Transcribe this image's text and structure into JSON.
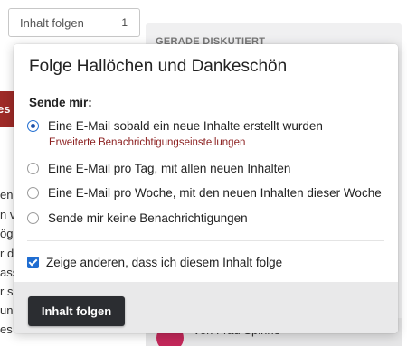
{
  "trigger": {
    "label": "Inhalt folgen",
    "count": "1"
  },
  "sidebar": {
    "title": "GERADE DISKUTIERT",
    "byline": "Von Frau Spinne"
  },
  "background": {
    "red_tab": "es",
    "text_lines": [
      "en",
      "n v",
      "ög",
      "r di",
      "ass",
      "r sie",
      "und",
      "es v"
    ]
  },
  "popover": {
    "title": "Folge Hallöchen und Dankeschön",
    "send_label": "Sende mir:",
    "options": [
      {
        "label": "Eine E-Mail sobald ein neue Inhalte erstellt wurden",
        "selected": true
      },
      {
        "label": "Eine E-Mail pro Tag, mit allen neuen Inhalten",
        "selected": false
      },
      {
        "label": "Eine E-Mail pro Woche, mit den neuen Inhalten dieser Woche",
        "selected": false
      },
      {
        "label": "Sende mir keine Benachrichtigungen",
        "selected": false
      }
    ],
    "advanced_link": "Erweiterte Benachrichtigungseinstellungen",
    "show_others": {
      "label": "Zeige anderen, dass ich diesem Inhalt folge",
      "checked": true
    },
    "submit": "Inhalt folgen"
  },
  "colors": {
    "primary_button": "#2b2d31",
    "link": "#8b1f1f",
    "accent": "#1f6dd1",
    "red_tab": "#9e2a27",
    "avatar": "#c3285a"
  }
}
